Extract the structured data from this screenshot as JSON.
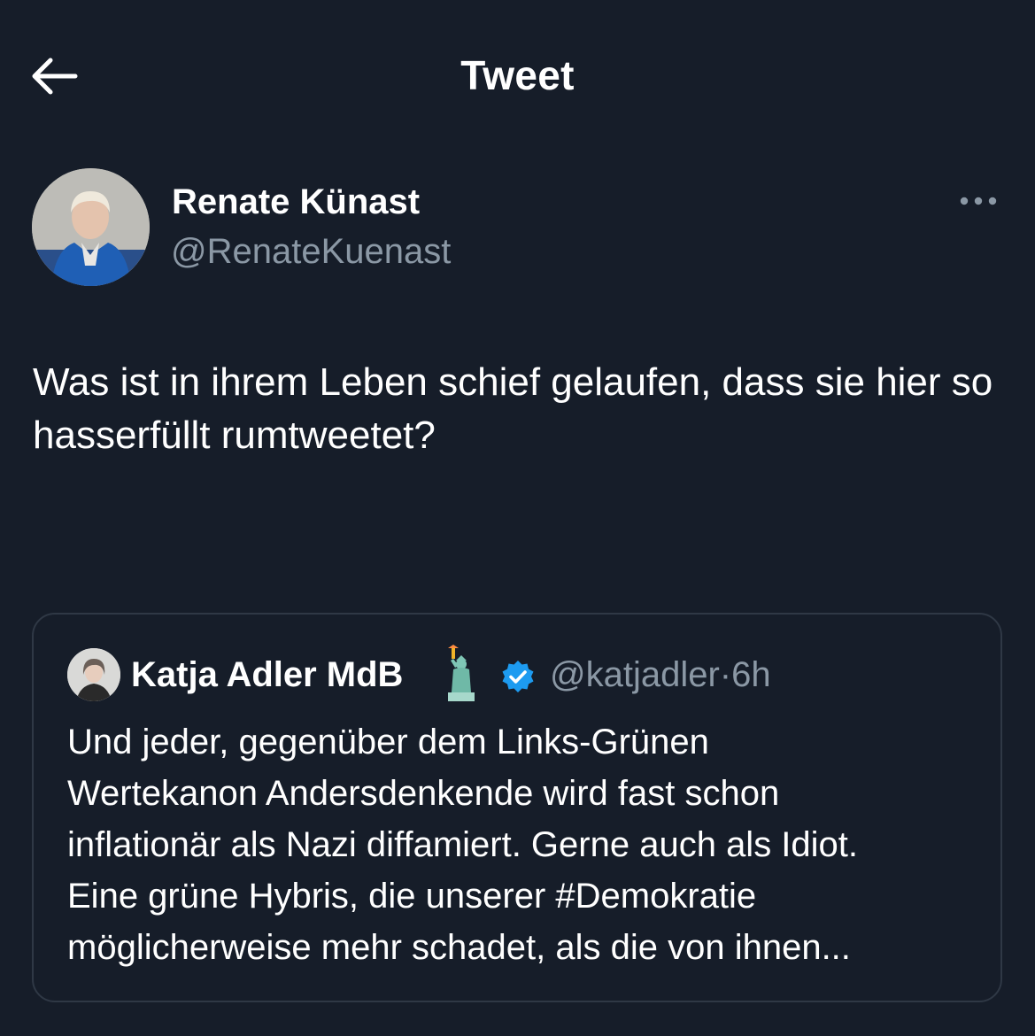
{
  "header": {
    "title": "Tweet",
    "back_icon": "arrow-left-icon"
  },
  "author": {
    "name": "Renate Künast",
    "handle": "@RenateKuenast",
    "more_icon": "ellipsis-icon"
  },
  "tweet": {
    "text": "Was ist in ihrem Leben schief gelaufen, dass sie hier so hasserfüllt rumtweetet?"
  },
  "quoted_tweet": {
    "name": "Katja Adler MdB",
    "emoji_icon": "statue-of-liberty-icon",
    "verified_icon": "verified-badge-icon",
    "handle": "@katjadler",
    "separator": "·",
    "time": "6h",
    "text": "Und jeder, gegenüber dem Links-Grünen\nWertekanon Andersdenkende wird fast schon\ninflationär als Nazi diffamiert. Gerne auch als Idiot.\nEine grüne Hybris, die unserer #Demokratie\nmöglicherweise  mehr schadet, als die von ihnen..."
  },
  "colors": {
    "background": "#161d29",
    "text_primary": "#ffffff",
    "text_secondary": "#8b98a5",
    "border": "#2f3845",
    "verified": "#1d9bf0"
  }
}
